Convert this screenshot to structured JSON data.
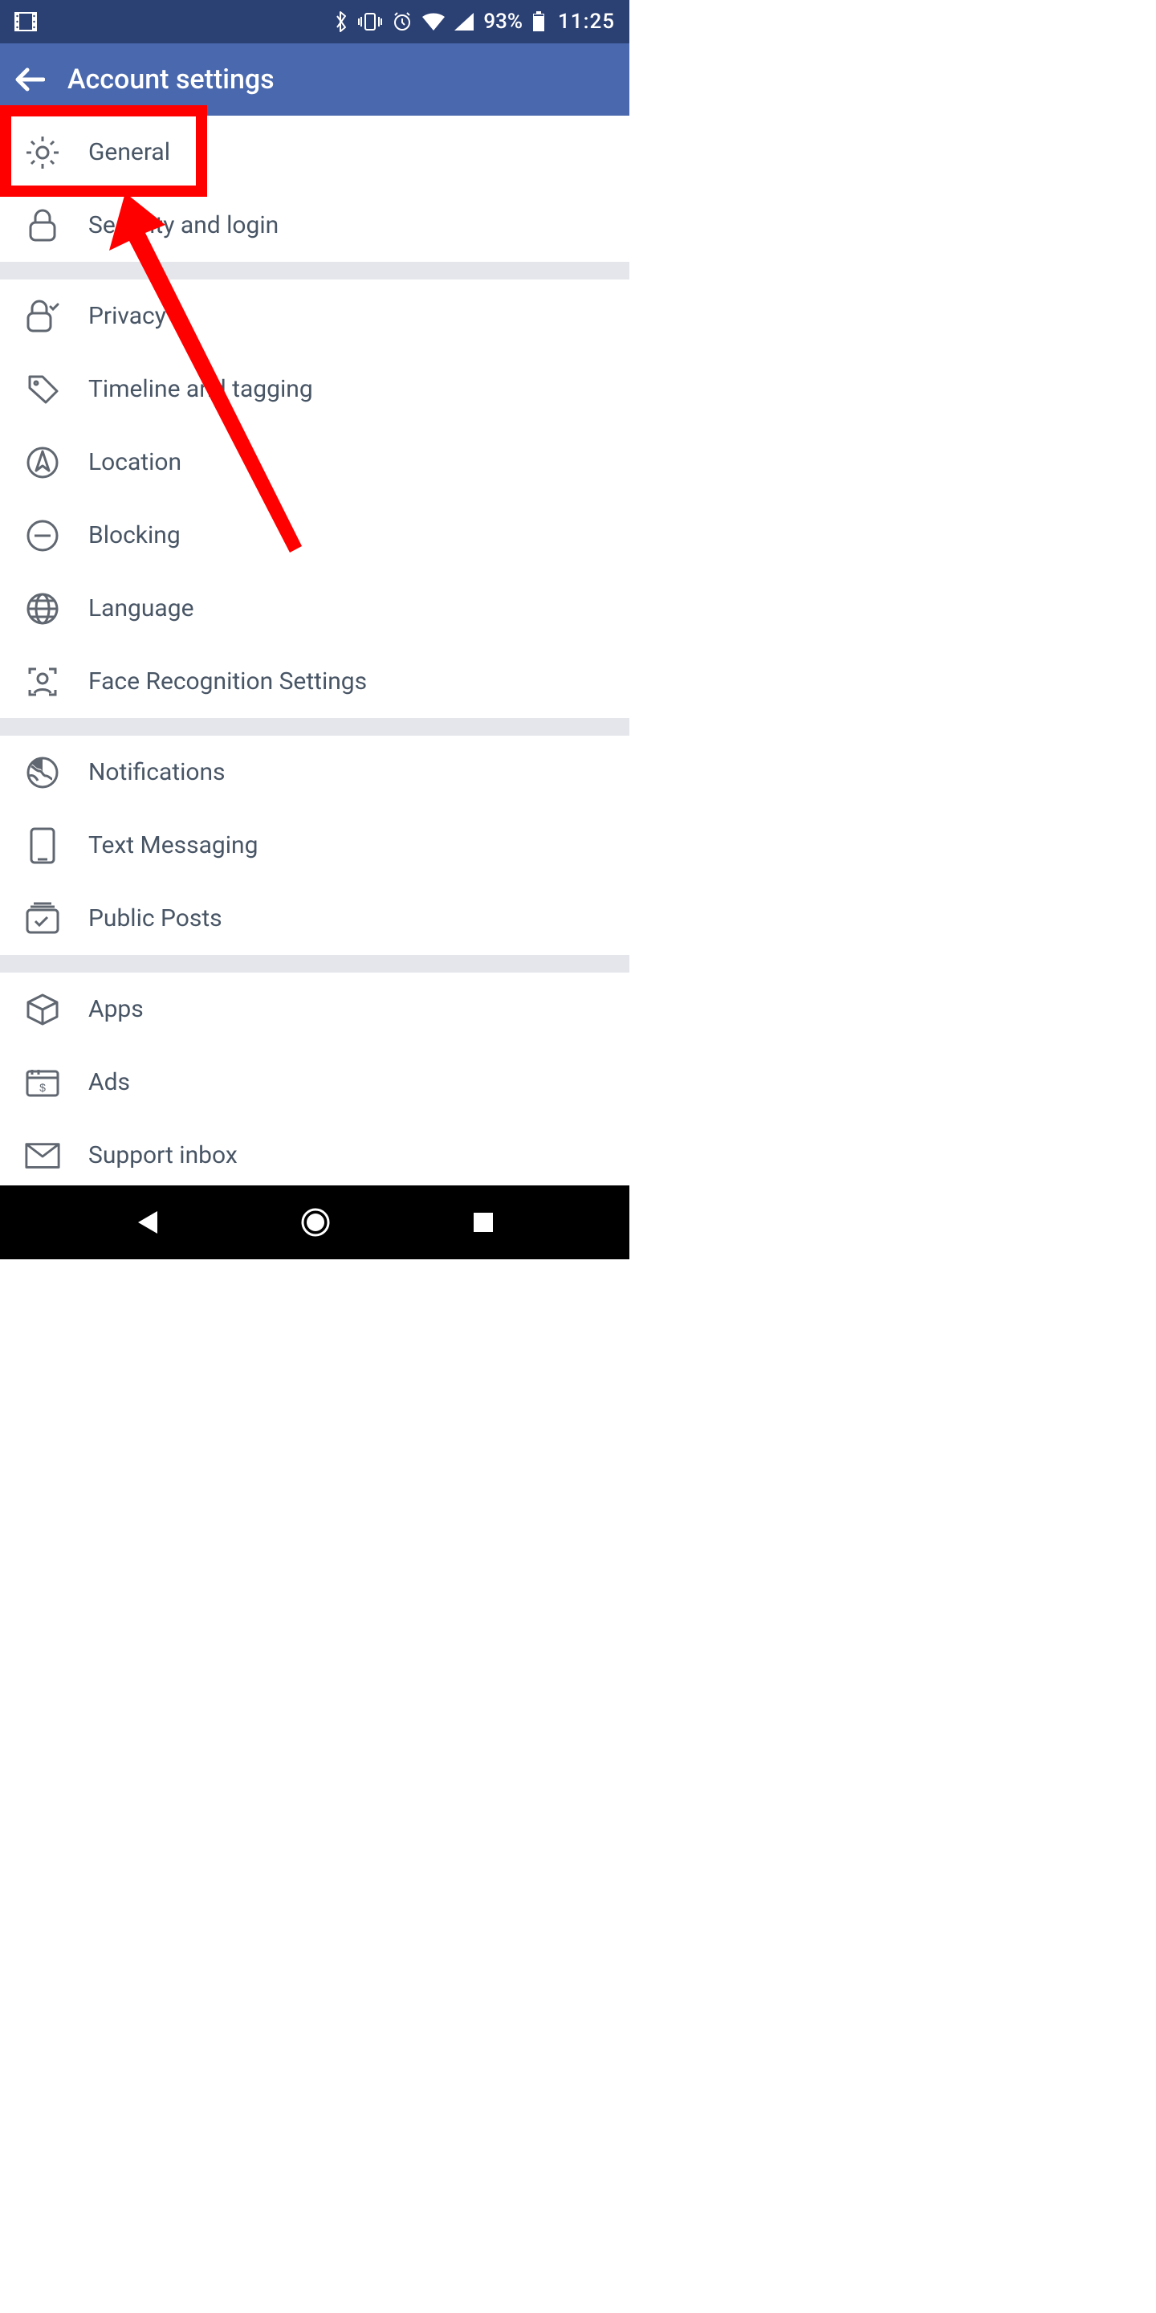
{
  "status_bar": {
    "battery_percent": "93%",
    "time": "11:25"
  },
  "app_bar": {
    "title": "Account settings"
  },
  "sections": [
    {
      "items": [
        {
          "icon": "gear-icon",
          "label": "General"
        },
        {
          "icon": "lock-icon",
          "label": "Security and login"
        }
      ]
    },
    {
      "items": [
        {
          "icon": "lock-check-icon",
          "label": "Privacy"
        },
        {
          "icon": "tag-icon",
          "label": "Timeline and tagging"
        },
        {
          "icon": "compass-icon",
          "label": "Location"
        },
        {
          "icon": "minus-circle-icon",
          "label": "Blocking"
        },
        {
          "icon": "globe-icon",
          "label": "Language"
        },
        {
          "icon": "face-icon",
          "label": "Face Recognition Settings"
        }
      ]
    },
    {
      "items": [
        {
          "icon": "world-icon",
          "label": "Notifications"
        },
        {
          "icon": "phone-icon",
          "label": "Text Messaging"
        },
        {
          "icon": "posts-icon",
          "label": "Public Posts"
        }
      ]
    },
    {
      "items": [
        {
          "icon": "cube-icon",
          "label": "Apps"
        },
        {
          "icon": "ads-icon",
          "label": "Ads"
        },
        {
          "icon": "envelope-icon",
          "label": "Support inbox"
        }
      ]
    }
  ]
}
